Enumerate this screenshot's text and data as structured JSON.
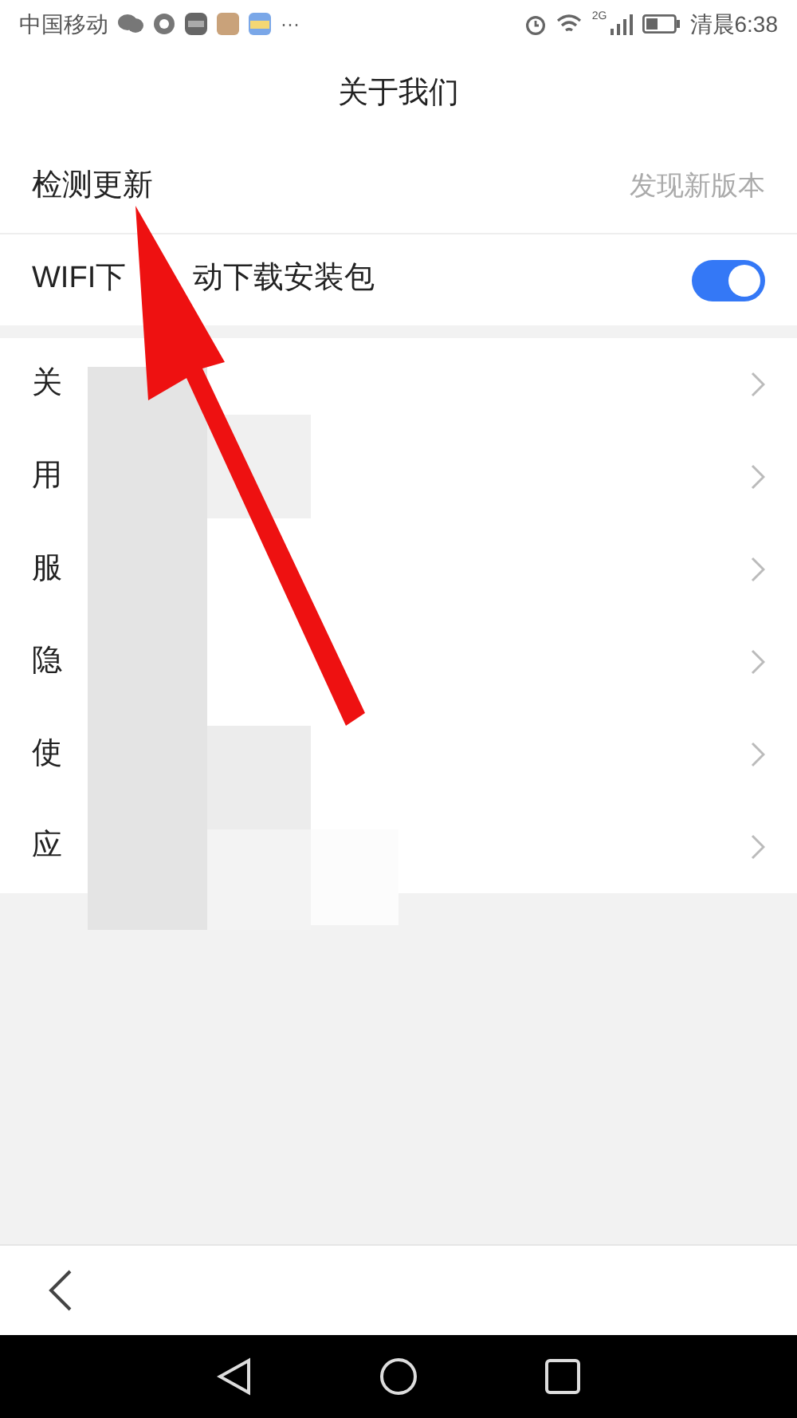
{
  "status_bar": {
    "carrier": "中国移动",
    "more": "···",
    "network": "2G",
    "time": "清晨6:38"
  },
  "title": "关于我们",
  "settings": [
    {
      "kind": "value",
      "label": "检测更新",
      "value": "发现新版本"
    },
    {
      "kind": "toggle",
      "label_parts": [
        "WIFI下",
        "动下载安装包"
      ],
      "on": true
    }
  ],
  "links": [
    {
      "label": "关"
    },
    {
      "label": "用"
    },
    {
      "label": "服"
    },
    {
      "label": "隐"
    },
    {
      "label": "使"
    },
    {
      "label": "应"
    }
  ]
}
